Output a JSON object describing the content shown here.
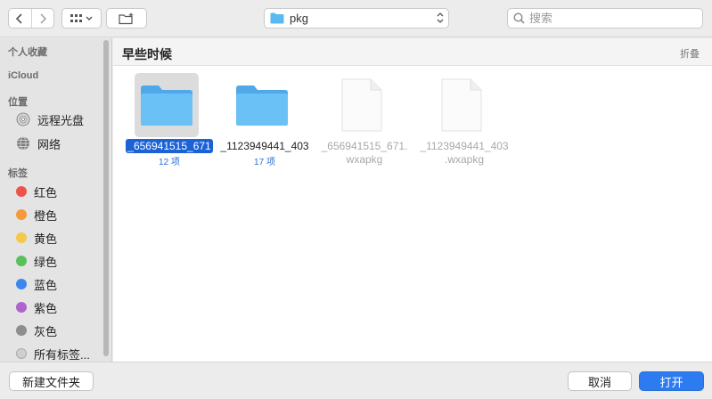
{
  "toolbar": {
    "path_label": "pkg",
    "search_placeholder": "搜索"
  },
  "sidebar": {
    "favorites_heading": "个人收藏",
    "icloud_heading": "iCloud",
    "locations_heading": "位置",
    "locations": [
      {
        "label": "远程光盘",
        "icon": "optical-disc-icon"
      },
      {
        "label": "网络",
        "icon": "network-globe-icon"
      }
    ],
    "tags_heading": "标签",
    "tags": [
      {
        "label": "红色",
        "color": "#f0524a"
      },
      {
        "label": "橙色",
        "color": "#f49a3a"
      },
      {
        "label": "黄色",
        "color": "#f6c84a"
      },
      {
        "label": "绿色",
        "color": "#5ac05a"
      },
      {
        "label": "蓝色",
        "color": "#3b86ef"
      },
      {
        "label": "紫色",
        "color": "#b062cf"
      },
      {
        "label": "灰色",
        "color": "#8e8e8e"
      },
      {
        "label": "所有标签...",
        "color": "#cfcfcf"
      }
    ]
  },
  "main": {
    "section_title": "早些时候",
    "fold_label": "折叠",
    "files": [
      {
        "name": "_656941515_671",
        "sub": "12 项",
        "type": "folder",
        "selected": true
      },
      {
        "name": "_1123949441_403",
        "sub": "17 项",
        "type": "folder",
        "selected": false
      },
      {
        "name_line1": "_656941515_671.",
        "name_line2": "wxapkg",
        "type": "file"
      },
      {
        "name_line1": "_1123949441_403",
        "name_line2": ".wxapkg",
        "type": "file"
      }
    ]
  },
  "bottom": {
    "new_folder_label": "新建文件夹",
    "cancel_label": "取消",
    "open_label": "打开"
  },
  "colors": {
    "accent": "#2d7bf0",
    "selection": "#1b62d6",
    "folder": "#5ab8f2"
  }
}
